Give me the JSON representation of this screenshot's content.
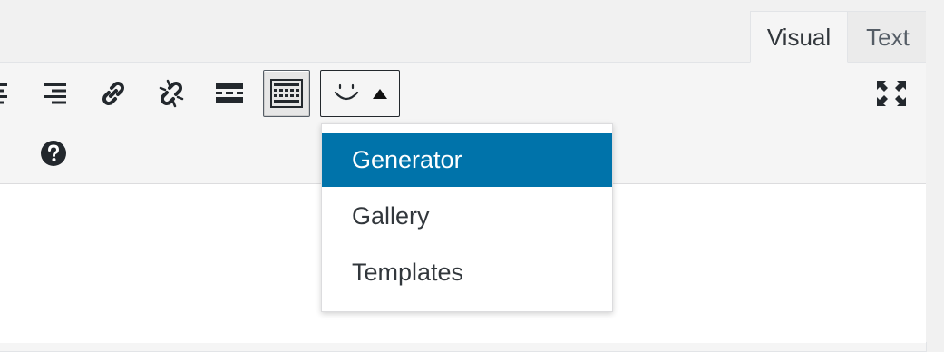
{
  "tabs": [
    {
      "label": "Visual",
      "active": true
    },
    {
      "label": "Text",
      "active": false
    }
  ],
  "toolbar": {
    "row1": [
      {
        "icon": "align-center-icon"
      },
      {
        "icon": "align-right-icon"
      },
      {
        "icon": "insert-link-icon"
      },
      {
        "icon": "remove-link-icon"
      },
      {
        "icon": "read-more-icon"
      },
      {
        "icon": "toolbar-toggle-icon",
        "active": true
      },
      {
        "icon": "smiley-icon",
        "menu": true,
        "open": true
      },
      {
        "icon": "fullscreen-icon"
      }
    ],
    "row2": [
      {
        "icon": "arrow-right-icon"
      },
      {
        "icon": "help-icon"
      }
    ]
  },
  "dropdown": {
    "items": [
      {
        "label": "Generator",
        "highlighted": true
      },
      {
        "label": "Gallery",
        "highlighted": false
      },
      {
        "label": "Templates",
        "highlighted": false
      }
    ]
  },
  "colors": {
    "accent": "#0073aa",
    "toolbar_bg": "#f5f5f5",
    "icon": "#23282d"
  }
}
